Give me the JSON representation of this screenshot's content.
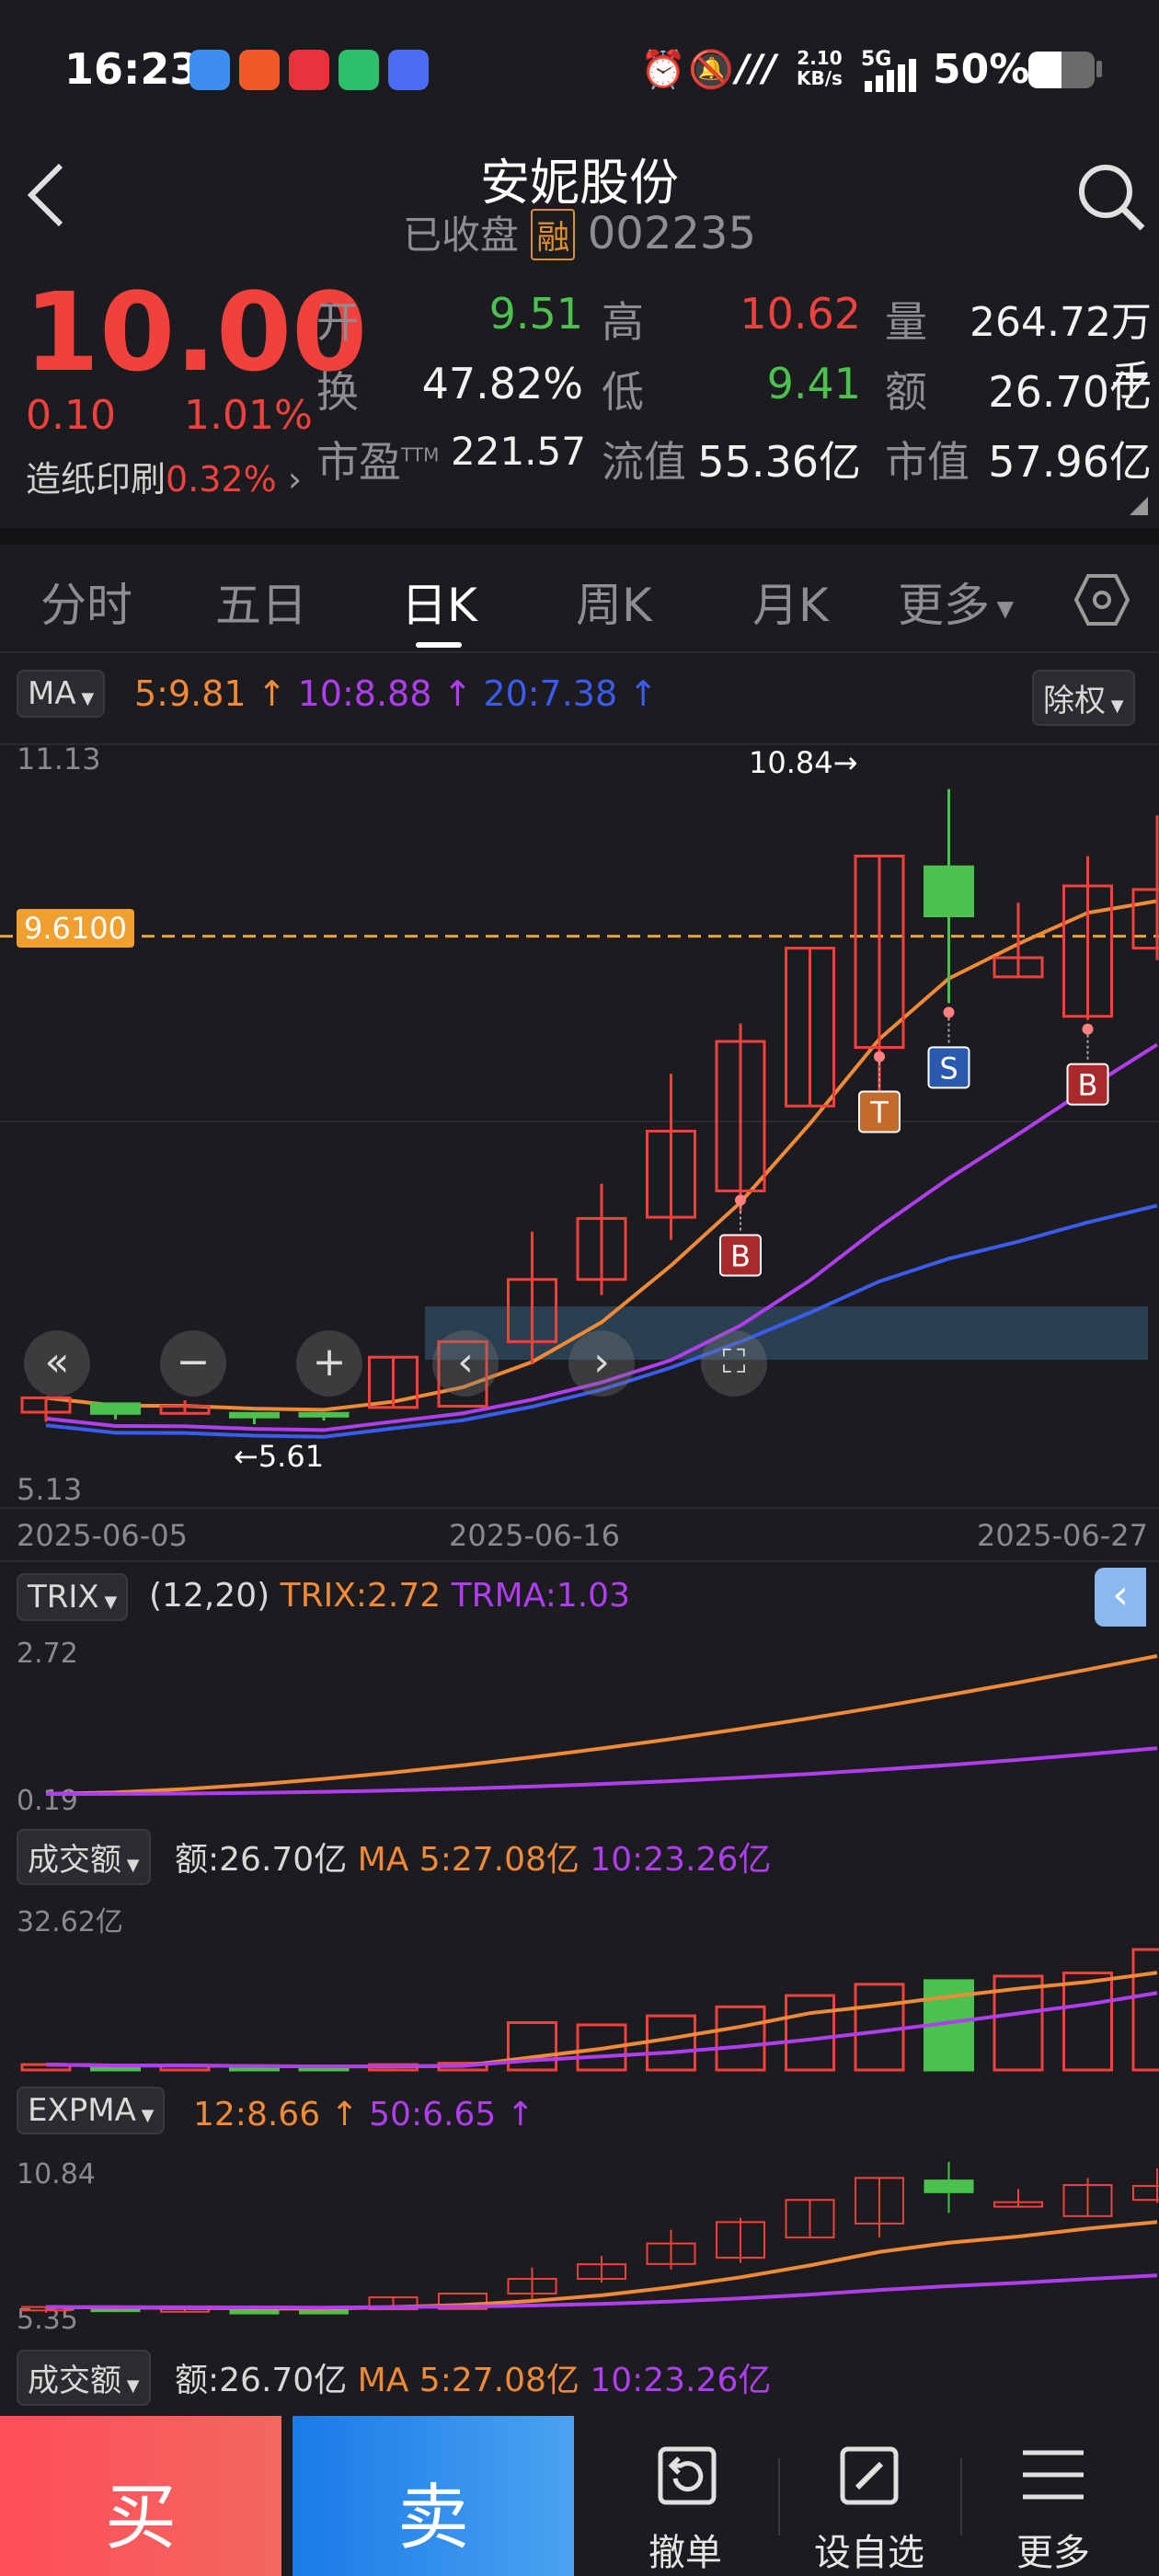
{
  "status": {
    "time": "16:23",
    "net_speed_top": "2.10",
    "net_speed_unit": "KB/s",
    "signal": "5G",
    "battery": "50%"
  },
  "header": {
    "title": "安妮股份",
    "state": "已收盘",
    "margin_badge": "融",
    "code": "002235"
  },
  "quote": {
    "price": "10.00",
    "change": "0.10",
    "pct": "1.01%",
    "industry": "造纸印刷",
    "industry_pct": "0.32%",
    "open_l": "开",
    "open_v": "9.51",
    "high_l": "高",
    "high_v": "10.62",
    "vol_l": "量",
    "vol_v": "264.72万手",
    "turn_l": "换",
    "turn_v": "47.82%",
    "low_l": "低",
    "low_v": "9.41",
    "amt_l": "额",
    "amt_v": "26.70亿",
    "pe_l": "市盈",
    "pe_sup": "TTM",
    "pe_v": "221.57",
    "float_l": "流值",
    "float_v": "55.36亿",
    "mcap_l": "市值",
    "mcap_v": "57.96亿"
  },
  "tabs": [
    "分时",
    "五日",
    "日K",
    "周K",
    "月K",
    "更多"
  ],
  "ma": {
    "label": "MA",
    "ma5": "5:9.81 ↑",
    "ma10": "10:8.88 ↑",
    "ma20": "20:7.38 ↑",
    "adj": "除权"
  },
  "kchart": {
    "ymax": "11.13",
    "ymin": "5.13",
    "price_line": "9.6100",
    "high_mark": "10.84→",
    "low_mark": "←5.61",
    "dates": [
      "2025-06-05",
      "2025-06-16",
      "2025-06-27"
    ],
    "signals": [
      "B",
      "T",
      "S",
      "B"
    ]
  },
  "trix": {
    "label": "TRIX",
    "params": "(12,20)",
    "trix": "TRIX:2.72",
    "trma": "TRMA:1.03",
    "ymax": "2.72",
    "ymin": "0.19"
  },
  "volume": {
    "label": "成交额",
    "amt": "额:26.70亿",
    "ma5": "MA 5:27.08亿",
    "ma10": "10:23.26亿",
    "ymax": "32.62亿"
  },
  "expma": {
    "label": "EXPMA",
    "e12": "12:8.66 ↑",
    "e50": "50:6.65 ↑",
    "ymax": "10.84",
    "ymin": "5.35"
  },
  "volume2": {
    "label": "成交额",
    "amt": "额:26.70亿",
    "ma5": "MA 5:27.08亿",
    "ma10": "10:23.26亿"
  },
  "bottom": {
    "buy": "买",
    "sell": "卖",
    "cancel": "撤单",
    "watch": "设自选",
    "more": "更多"
  },
  "chart_data": {
    "type": "candlestick",
    "dates": [
      "2025-06-05",
      "2025-06-06",
      "2025-06-09",
      "2025-06-10",
      "2025-06-11",
      "2025-06-12",
      "2025-06-13",
      "2025-06-16",
      "2025-06-17",
      "2025-06-18",
      "2025-06-19",
      "2025-06-20",
      "2025-06-23",
      "2025-06-24",
      "2025-06-25",
      "2025-06-26",
      "2025-06-27"
    ],
    "open": [
      5.63,
      5.7,
      5.62,
      5.62,
      5.62,
      5.67,
      5.68,
      6.22,
      6.74,
      7.26,
      7.48,
      8.19,
      8.68,
      10.19,
      9.27,
      8.94,
      9.51
    ],
    "close": [
      5.75,
      5.62,
      5.68,
      5.59,
      5.61,
      6.09,
      6.22,
      6.74,
      7.25,
      7.98,
      8.73,
      9.51,
      10.28,
      9.78,
      9.43,
      10.03,
      10.0
    ],
    "high": [
      5.75,
      5.7,
      5.73,
      5.62,
      5.63,
      6.09,
      6.22,
      7.14,
      7.54,
      8.46,
      8.88,
      9.51,
      10.28,
      10.84,
      9.89,
      10.28,
      10.62
    ],
    "low": [
      5.55,
      5.57,
      5.61,
      5.53,
      5.56,
      5.66,
      6.22,
      6.03,
      6.61,
      7.07,
      7.3,
      8.19,
      8.19,
      9.05,
      9.27,
      8.91,
      9.41
    ]
  }
}
